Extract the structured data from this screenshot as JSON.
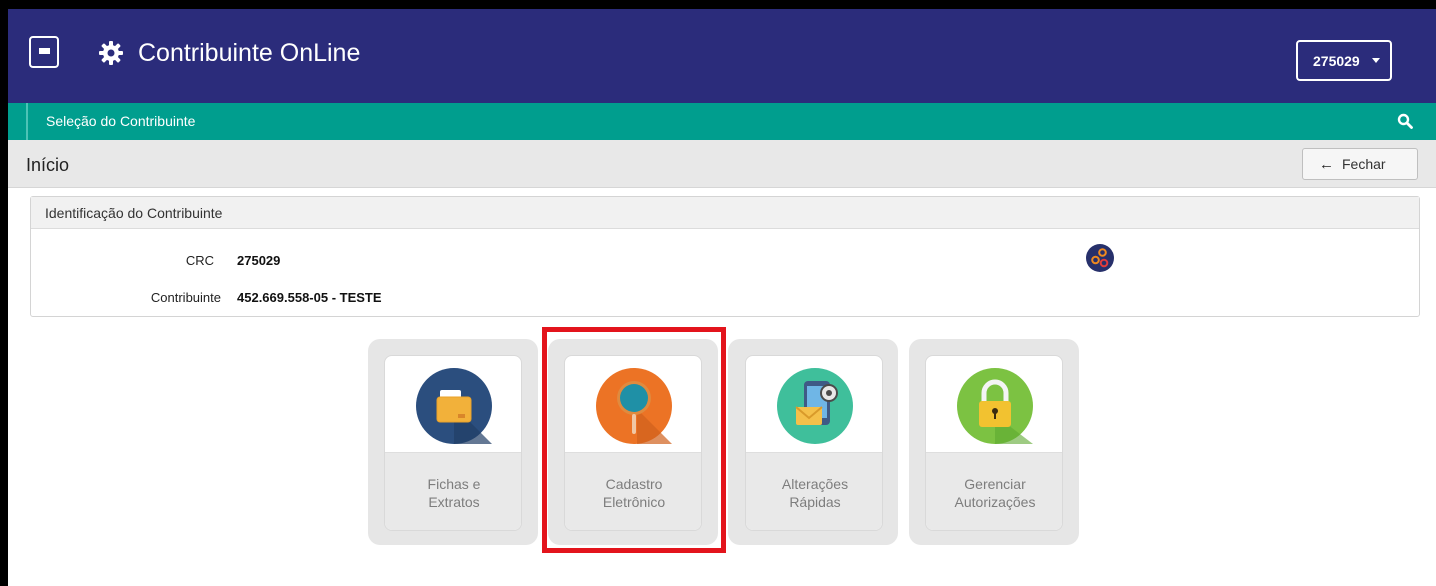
{
  "header": {
    "app_title": "Contribuinte OnLine",
    "menu_icon": "hamburger-icon",
    "app_icon": "gear-icon",
    "user_select_value": "275029",
    "brand_color": "#2b2c7b"
  },
  "subnav": {
    "label": "Seleção do Contribuinte",
    "search_icon": "search-icon",
    "accent_color": "#009e8e"
  },
  "page": {
    "title": "Início",
    "close_label": "Fechar"
  },
  "panel": {
    "heading": "Identificação do Contribuinte",
    "rows": [
      {
        "label": "CRC",
        "value": "275029"
      },
      {
        "label": "Contribuinte",
        "value": "452.669.558-05 - TESTE"
      }
    ],
    "action_icon": "bug-icon"
  },
  "tiles": [
    {
      "line1": "Fichas e",
      "line2": "Extratos",
      "icon": "folder-icon"
    },
    {
      "line1": "Cadastro",
      "line2": "Eletrônico",
      "icon": "magnifier-icon"
    },
    {
      "line1": "Alterações",
      "line2": "Rápidas",
      "icon": "phone-settings-icon"
    },
    {
      "line1": "Gerenciar",
      "line2": "Autorizações",
      "icon": "lock-icon"
    }
  ],
  "highlight_color": "#e3141c"
}
